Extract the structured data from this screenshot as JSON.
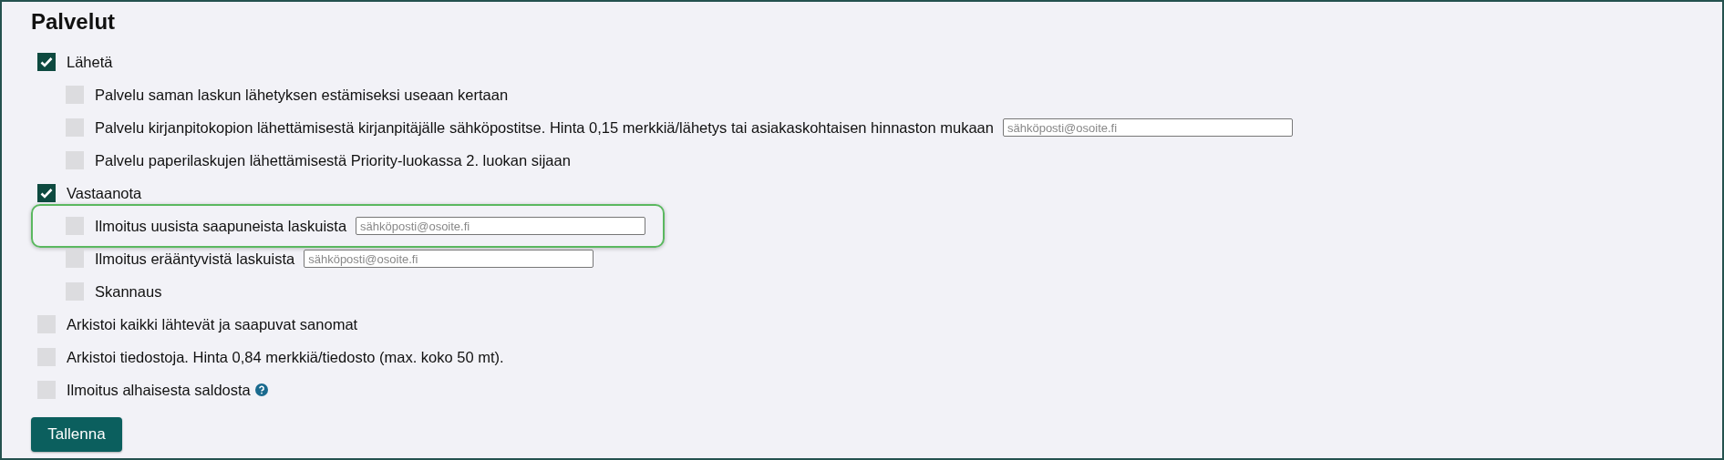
{
  "title": "Palvelut",
  "services": [
    {
      "label": "Lähetä",
      "checked": true,
      "children": [
        {
          "label": "Palvelu saman laskun lähetyksen estämiseksi useaan kertaan",
          "checked": false
        },
        {
          "label": "Palvelu kirjanpitokopion lähettämisestä kirjanpitäjälle sähköpostitse. Hinta 0,15 merkkiä/lähetys tai asiakaskohtaisen hinnaston mukaan",
          "checked": false,
          "input": {
            "placeholder": "sähköposti@osoite.fi"
          }
        },
        {
          "label": "Palvelu paperilaskujen lähettämisestä Priority-luokassa 2. luokan sijaan",
          "checked": false
        }
      ]
    },
    {
      "label": "Vastaanota",
      "checked": true,
      "children": [
        {
          "label": "Ilmoitus uusista saapuneista laskuista",
          "checked": false,
          "highlighted": true,
          "input": {
            "placeholder": "sähköposti@osoite.fi"
          }
        },
        {
          "label": "Ilmoitus erääntyvistä laskuista",
          "checked": false,
          "input": {
            "placeholder": "sähköposti@osoite.fi"
          }
        },
        {
          "label": "Skannaus",
          "checked": false
        }
      ]
    },
    {
      "label": "Arkistoi kaikki lähtevät ja saapuvat sanomat",
      "checked": false
    },
    {
      "label": "Arkistoi tiedostoja. Hinta 0,84 merkkiä/tiedosto (max. koko 50 mt).",
      "checked": false
    },
    {
      "label": "Ilmoitus alhaisesta saldosta",
      "checked": false,
      "help": true
    }
  ],
  "save_button": "Tallenna"
}
